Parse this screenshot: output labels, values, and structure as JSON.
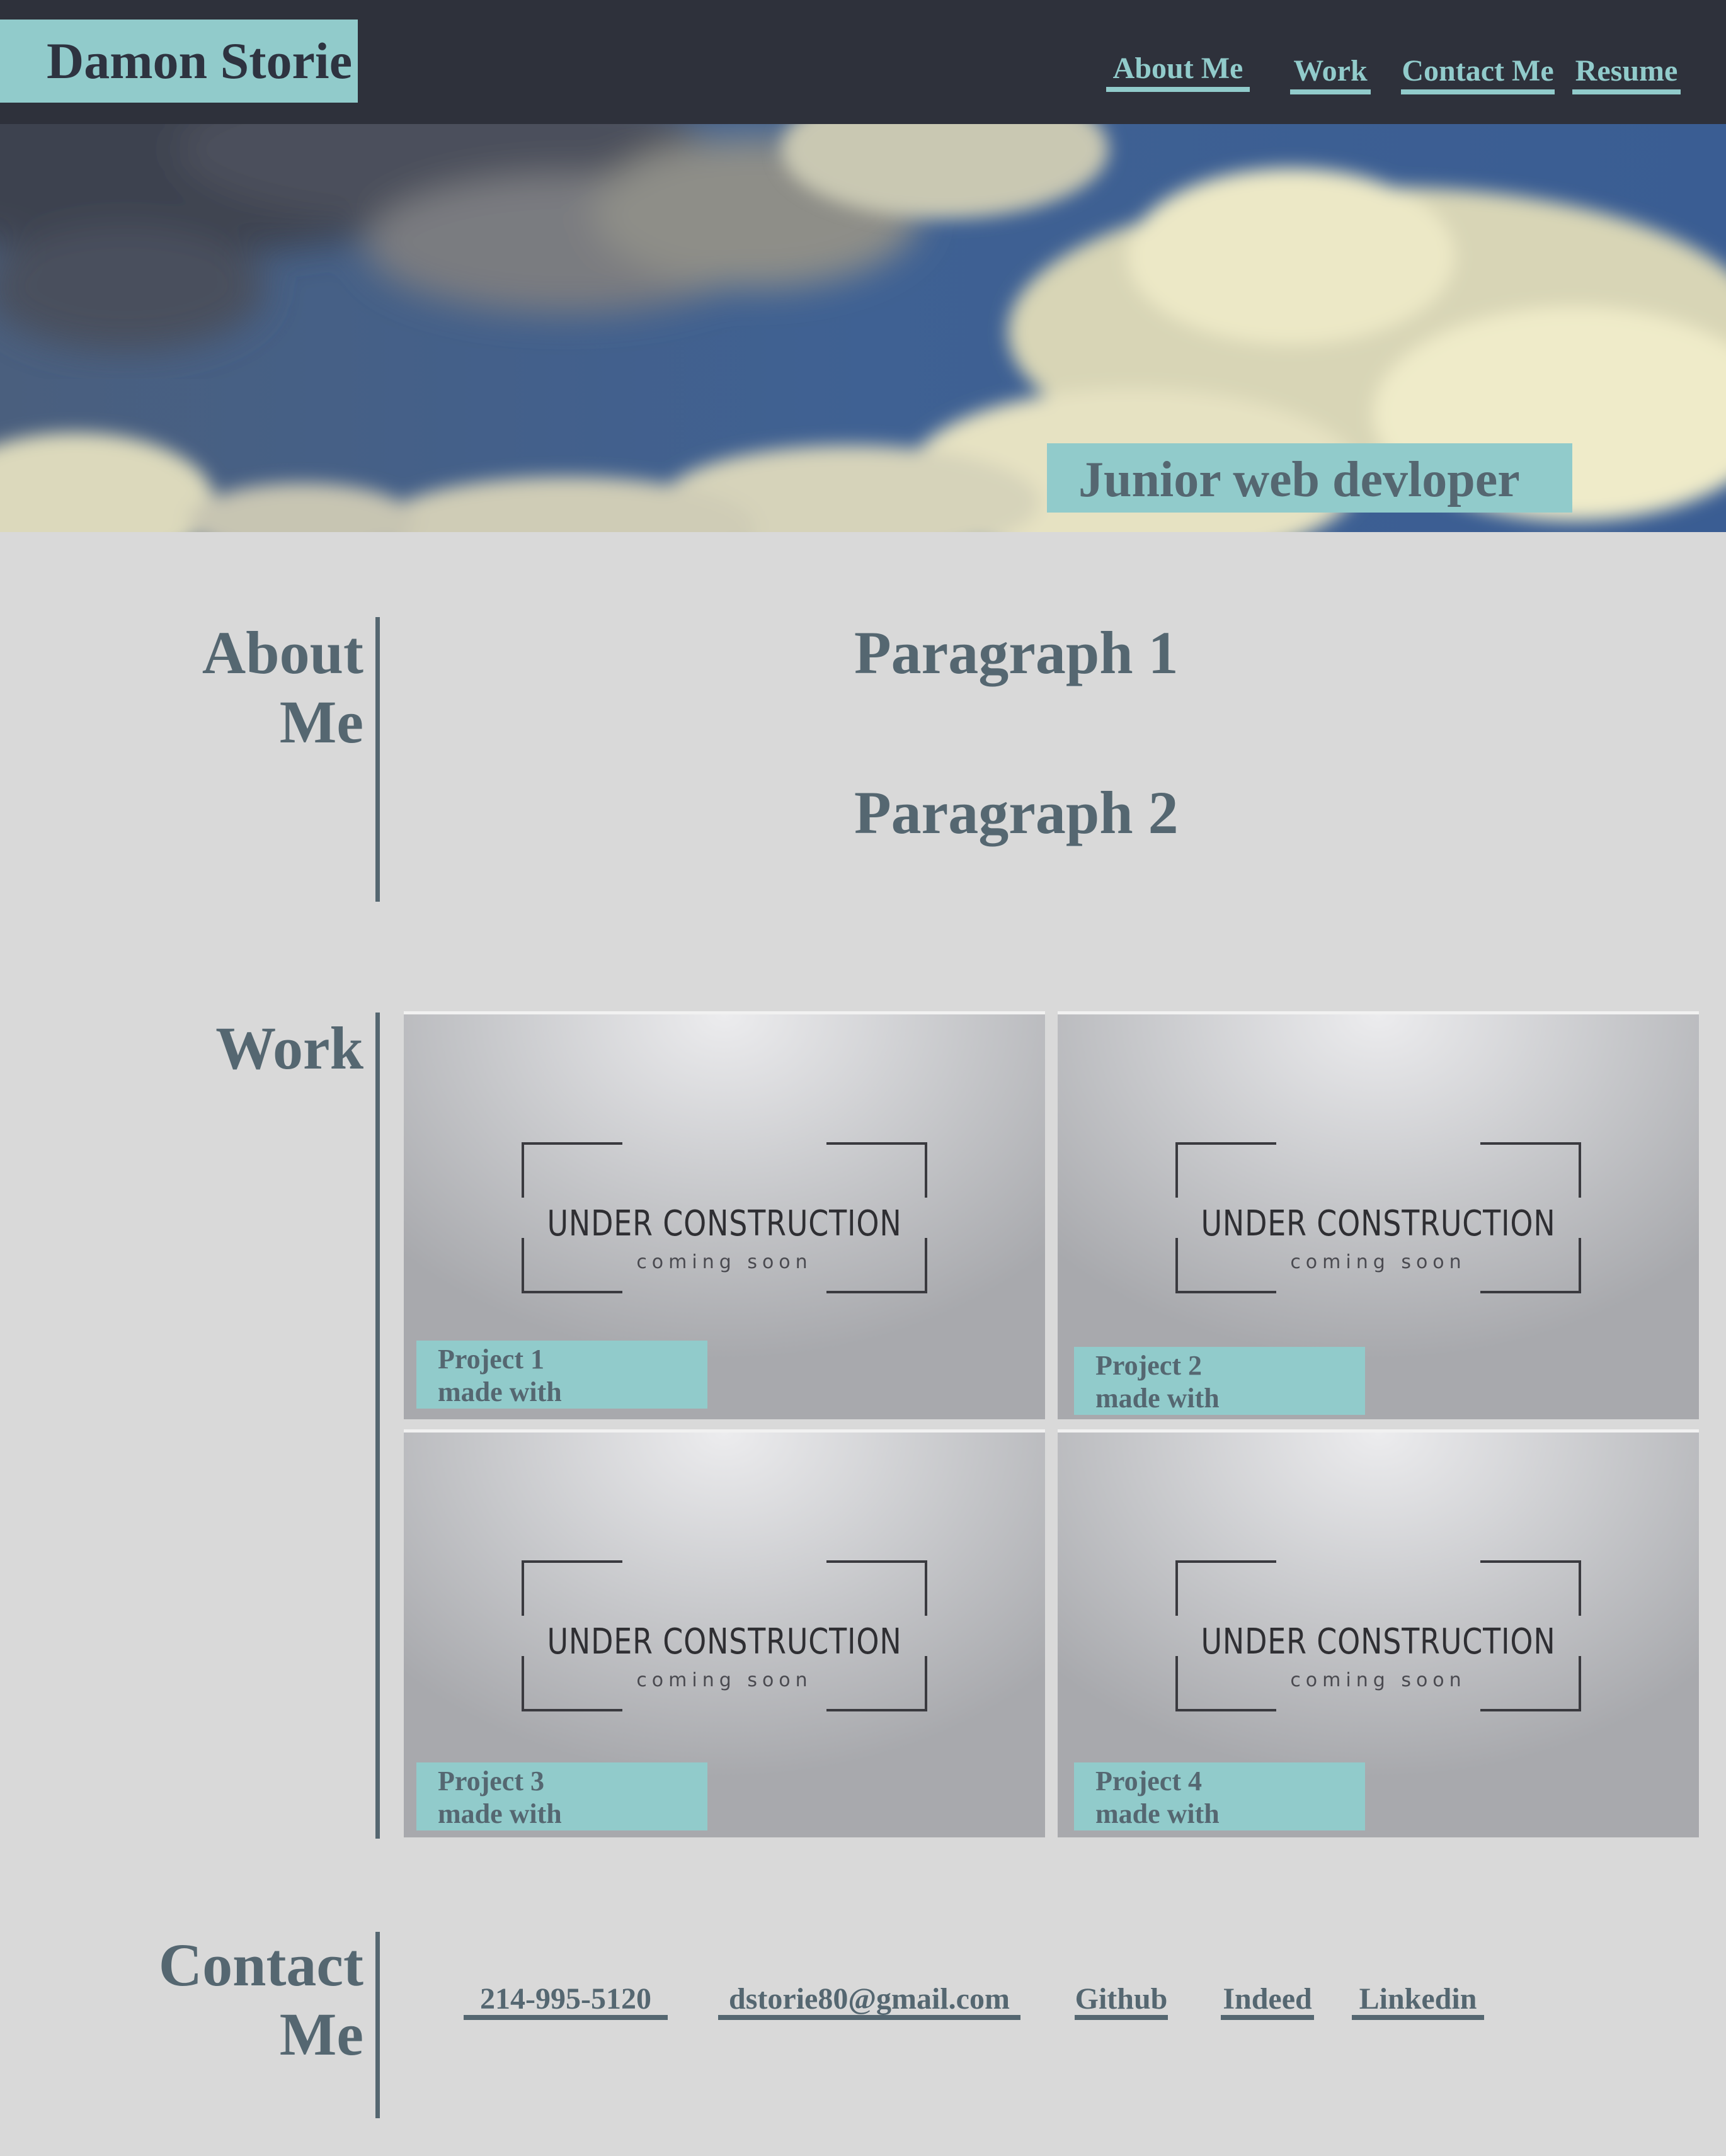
{
  "header": {
    "brand": "Damon Storie",
    "nav": [
      "About Me",
      "Work",
      "Contact Me",
      "Resume"
    ]
  },
  "hero": {
    "tagline": "Junior web devloper"
  },
  "about": {
    "title_line1": "About",
    "title_line2": "Me",
    "paragraphs": [
      "Paragraph 1",
      "Paragraph 2"
    ]
  },
  "work": {
    "title": "Work",
    "placeholder_title": "UNDER CONSTRUCTION",
    "placeholder_sub": "coming soon",
    "projects": [
      {
        "name": "Project 1",
        "made_with": "made with"
      },
      {
        "name": "Project 2",
        "made_with": "made with"
      },
      {
        "name": "Project 3",
        "made_with": "made with"
      },
      {
        "name": "Project 4",
        "made_with": "made with"
      }
    ]
  },
  "contact": {
    "title_line1": "Contact",
    "title_line2": "Me",
    "links": [
      "214-995-5120",
      "dstorie80@gmail.com",
      "Github",
      "Indeed",
      "Linkedin"
    ]
  },
  "colors": {
    "header_bg": "#2e313b",
    "accent": "#91cbcb",
    "text_slate": "#556771",
    "page_bg": "#d9d9d9"
  }
}
